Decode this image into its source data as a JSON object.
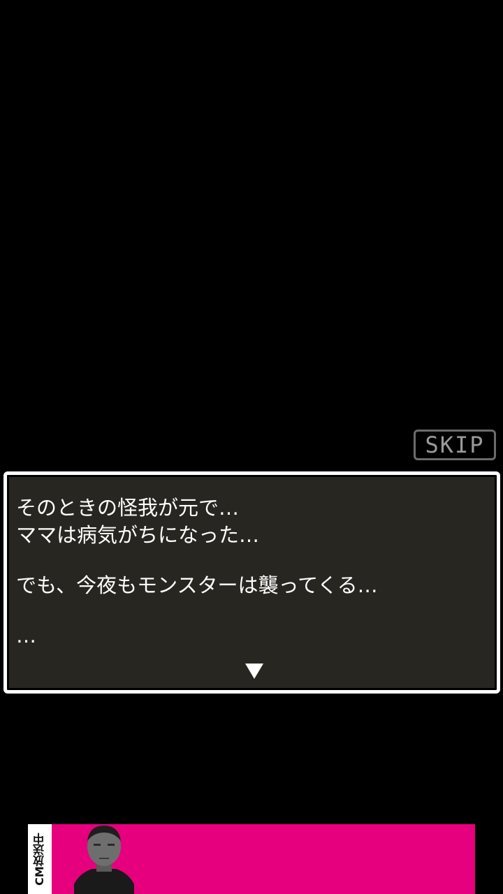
{
  "skip": {
    "label": "SKIP"
  },
  "dialog": {
    "lines": [
      "そのときの怪我が元で…",
      "ママは病気がちになった…",
      "でも、今夜もモンスターは襲ってくる…",
      "…"
    ],
    "advance_icon": "down-triangle-icon"
  },
  "ad": {
    "badge_text": "CM放送中",
    "accent_color": "#e6007e"
  },
  "colors": {
    "background": "#000000",
    "dialog_bg": "#282621",
    "dialog_border": "#ffffff",
    "skip_border": "#6b6b6b"
  }
}
